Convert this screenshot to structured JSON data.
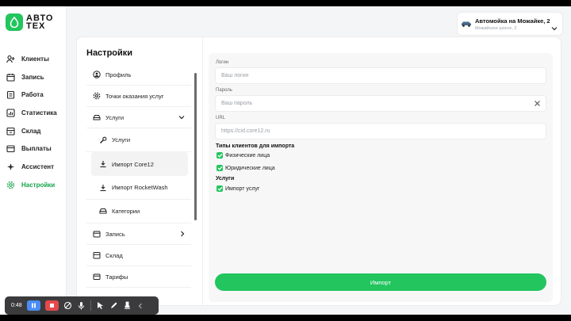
{
  "logo": {
    "line1": "АВТО",
    "line2": "ТЕХ"
  },
  "sidebar": {
    "items": [
      {
        "label": "Клиенты",
        "icon": "user-plus-icon"
      },
      {
        "label": "Запись",
        "icon": "calendar-icon"
      },
      {
        "label": "Работа",
        "icon": "clipboard-icon"
      },
      {
        "label": "Статистика",
        "icon": "chart-icon"
      },
      {
        "label": "Склад",
        "icon": "warehouse-icon"
      },
      {
        "label": "Выплаты",
        "icon": "wallet-icon"
      },
      {
        "label": "Ассистент",
        "icon": "sparkle-icon"
      },
      {
        "label": "Настройки",
        "icon": "gear-icon",
        "active": true
      }
    ]
  },
  "account": {
    "name": "Автомойка на Можайке, 2",
    "sub": "Можайское шоссе, 2"
  },
  "settings": {
    "title": "Настройки",
    "menu": {
      "profile": "Профиль",
      "points": "Точки оказания услуг",
      "services": "Услуги",
      "services_sub": "Услуги",
      "import_core": "Импорт Core12",
      "import_rocket": "Импорт RocketWash",
      "categories": "Категории",
      "booking": "Запись",
      "warehouse": "Склад",
      "tariffs": "Тарифы"
    }
  },
  "form": {
    "login_label": "Логин",
    "login_placeholder": "Ваш логин",
    "password_label": "Пароль",
    "password_placeholder": "Ваш пароль",
    "url_label": "URL",
    "url_placeholder": "https://cid.core12.ru",
    "client_types_title": "Типы клиентов для импорта",
    "individuals": "Физические лица",
    "legal": "Юридические лица",
    "services_title": "Услуги",
    "import_services": "Импорт услуг",
    "import_button": "Импорт"
  },
  "recorder": {
    "time": "0:48"
  },
  "colors": {
    "accent": "#22c55e",
    "record_pause": "#4a8cf7",
    "record_stop": "#e5484d"
  }
}
